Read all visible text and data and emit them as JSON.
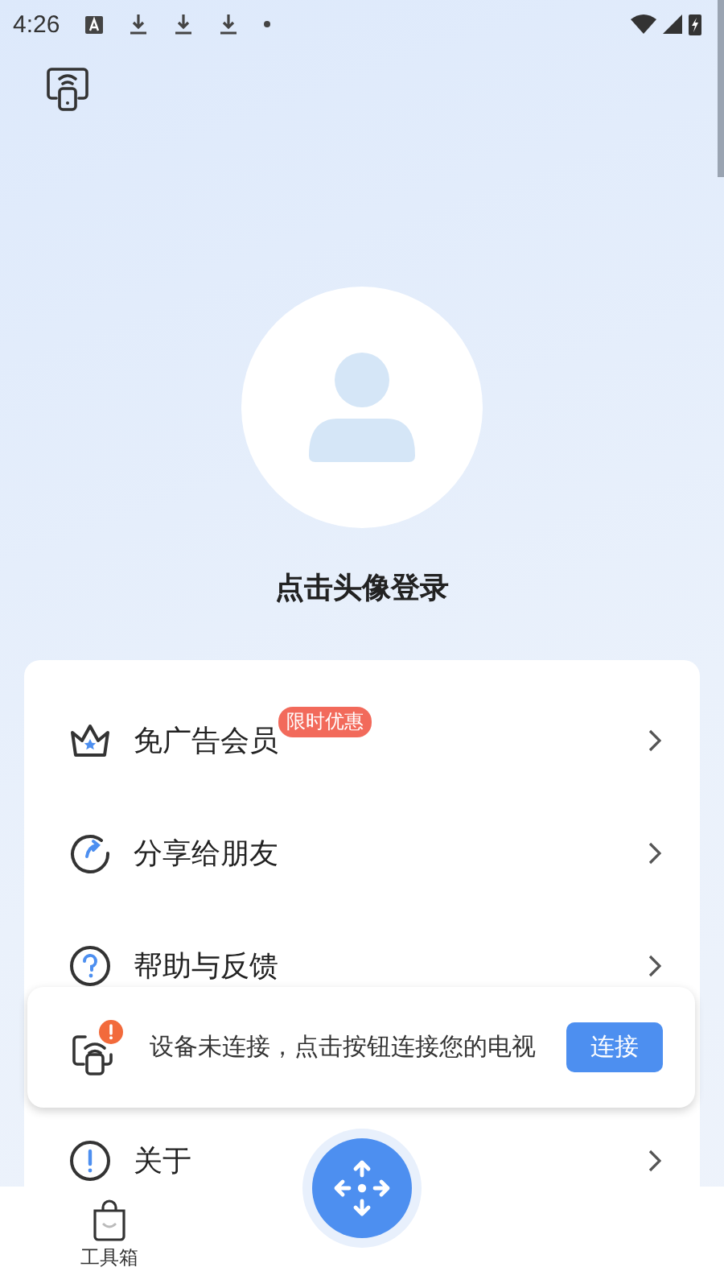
{
  "status_bar": {
    "time": "4:26"
  },
  "profile": {
    "login_text": "点击头像登录"
  },
  "menu": [
    {
      "kind": "crown",
      "label": "免广告会员",
      "badge": "限时优惠"
    },
    {
      "kind": "share",
      "label": "分享给朋友"
    },
    {
      "kind": "help",
      "label": "帮助与反馈"
    },
    {
      "kind": "info",
      "label": "关于"
    }
  ],
  "connect_banner": {
    "message": "设备未连接，点击按钮连接您的电视",
    "button": "连接"
  },
  "bottom_nav": [
    {
      "label": "工具箱"
    }
  ]
}
